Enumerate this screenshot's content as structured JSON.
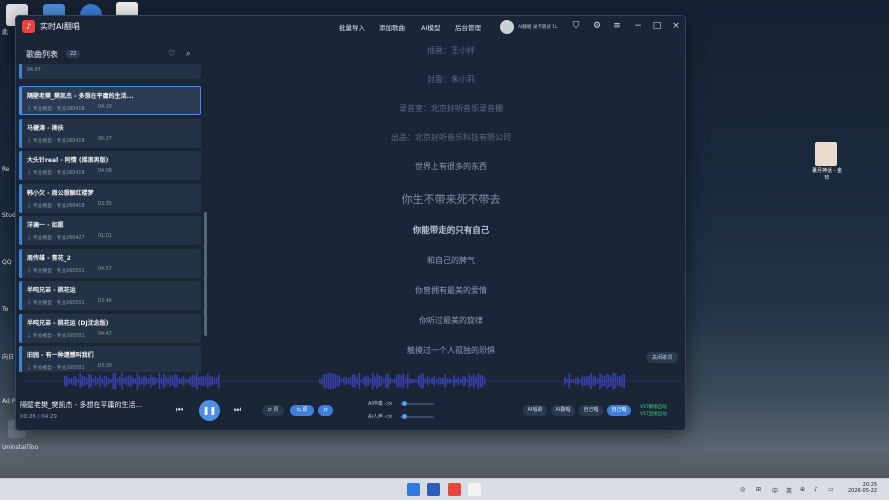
{
  "desktop": {
    "left_labels": [
      "此",
      "Re",
      "Studi",
      "QQ",
      "To",
      "向日",
      "Ad Phot"
    ],
    "uninstall_label": "UninstallToo",
    "right_icon_label": "董月神话 - 金珍"
  },
  "app": {
    "title": "实时AI翻唱",
    "nav": [
      "批量导入",
      "添加歌曲",
      "AI模型",
      "后台管理"
    ],
    "user": "AI翻唱 录卡随试 1L"
  },
  "sidebar": {
    "title": "歌曲列表",
    "count": "22",
    "partial_time": "04:07",
    "songs": [
      {
        "title": "隔壁老樊_樊凯杰 - 多想在平庸的生活...",
        "meta": "♫ 专业模型 · 专业260418",
        "duration": "04:29",
        "active": true
      },
      {
        "title": "马健涛 - 搀扶",
        "meta": "♫ 专业模型 · 专业260418",
        "duration": "05:27",
        "active": false
      },
      {
        "title": "大头针real - 阿情 (摇滚男版)",
        "meta": "♫ 专业模型 · 专业260418",
        "duration": "04:09",
        "active": false
      },
      {
        "title": "韩小欠 - 周公想解红楼梦",
        "meta": "♫ 专业模型 · 专业260418",
        "duration": "03:35",
        "active": false
      },
      {
        "title": "洋澜一 - 如愿",
        "meta": "♫ 专业模型 · 专业260427",
        "duration": "01:01",
        "active": false
      },
      {
        "title": "周传雄 - 青花_2",
        "meta": "♫ 专业模型 · 专业260501",
        "duration": "04:57",
        "active": false
      },
      {
        "title": "半吨兄弟 - 桃花运",
        "meta": "♫ 专业模型 · 专业260501",
        "duration": "03:46",
        "active": false
      },
      {
        "title": "半吨兄弟 - 桃花运 (DJ沈念版)",
        "meta": "♫ 专业模型 · 专业260501",
        "duration": "04:47",
        "active": false
      },
      {
        "title": "旧园 - 有一种遗憾叫我们",
        "meta": "♫ 专业模型 · 专业260501",
        "duration": "03:30",
        "active": false
      }
    ]
  },
  "lyrics": {
    "lines": [
      "插画：王小拌",
      "封面：朱小莉",
      "录音室：北京好听音乐录音棚",
      "出品：北京好听音乐科技有限公司",
      "世界上有很多的东西",
      "你生不带来死不带去",
      "你能带走的只有自己",
      "和自己的脾气",
      "你曾拥有最美的爱情",
      "你听过最美的旋律",
      "触摸过一个人孤独的恐惧"
    ],
    "close_label": "关闭歌词"
  },
  "player": {
    "now_playing": "隔壁老樊_樊凯杰 - 多想在平庸的生活...",
    "time": "00:26 / 04:29",
    "pills": [
      "⇄ 原",
      "⇆ 原",
      "⇄"
    ],
    "ai_accompany": "AI伴奏 ◁×",
    "ai_voice": "AI人声 ◁×",
    "accompany_level": 0.05,
    "voice_level": 0.05,
    "modes": [
      "AI唱歌",
      "AI翻唱",
      "自己唱",
      "自己唱"
    ],
    "vst": [
      "VST翻唱启动",
      "VST直接启动"
    ]
  },
  "taskbar": {
    "tray_items": [
      "◎",
      "⊞",
      "中",
      "英",
      "⊕",
      "♪",
      "▭"
    ],
    "clock_time": "20:25",
    "clock_date": "2026-05-22"
  },
  "colors": {
    "accent": "#3f7fd9",
    "wave": "#3a3fa8",
    "row_bg": "#233244"
  }
}
